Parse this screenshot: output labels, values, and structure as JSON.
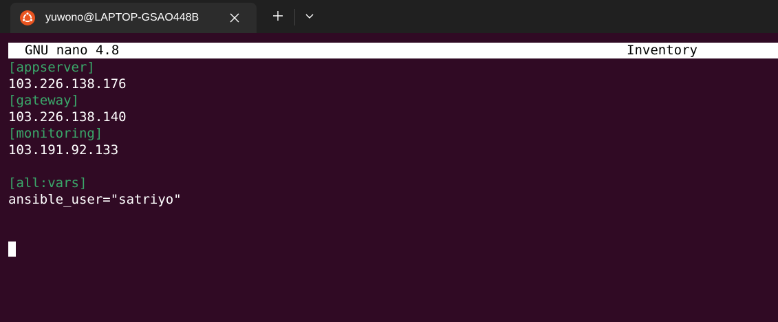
{
  "window": {
    "tab_title": "yuwono@LAPTOP-GSAO448B",
    "tab_icon": "ubuntu-logo-icon",
    "close_icon": "close-icon",
    "new_tab_icon": "plus-icon",
    "dropdown_icon": "chevron-down-icon"
  },
  "nano": {
    "version": "GNU nano 4.8",
    "filename": "Inventory"
  },
  "buffer": {
    "lines": [
      "[appserver]",
      "103.226.138.176",
      "[gateway]",
      "103.226.138.140",
      "[monitoring]",
      "103.191.92.133",
      "",
      "[all:vars]",
      "ansible_user=\"satriyo\""
    ]
  },
  "colors": {
    "terminal_bg": "#300a24",
    "section_header": "#3aa86a",
    "ubuntu_orange": "#e95420"
  }
}
